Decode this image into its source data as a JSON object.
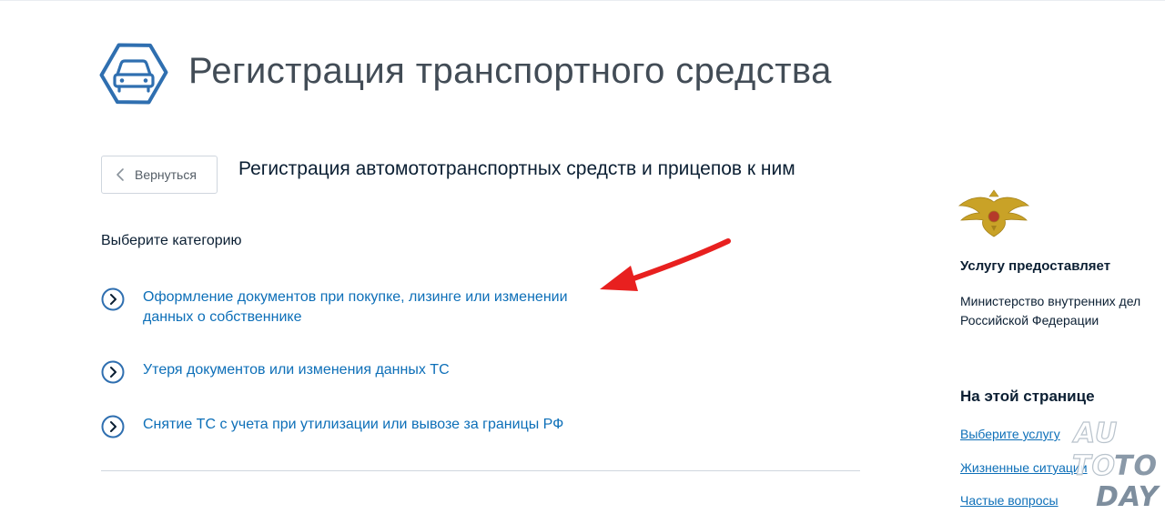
{
  "header": {
    "title": "Регистрация транспортного средства",
    "icon": "car-icon"
  },
  "nav": {
    "back_label": "Вернуться"
  },
  "service": {
    "subtitle": "Регистрация автомототранспортных средств и прицепов к ним",
    "choose_label": "Выберите категорию",
    "options": [
      {
        "label": "Оформление документов при покупке, лизинге или изменении данных о собственнике",
        "icon": "chevron-right-circle-icon"
      },
      {
        "label": "Утеря документов или изменения данных ТС",
        "icon": "chevron-right-circle-icon"
      },
      {
        "label": "Снятие ТС с учета при утилизации или вывозе за границы РФ",
        "icon": "chevron-right-circle-icon"
      }
    ]
  },
  "sidebar": {
    "emblem": "emblem-icon",
    "provider_heading": "Услугу предоставляет",
    "provider_name": "Министерство внутренних дел Российской Федерации",
    "toc_heading": "На этой странице",
    "toc_links": [
      "Выберите услугу",
      "Жизненные ситуации",
      "Частые вопросы"
    ]
  },
  "watermark": {
    "line1": "AU",
    "line2a": "TO",
    "line2b": "TO",
    "line3": "DAY"
  },
  "colors": {
    "accent": "#0d6fb8",
    "icon_blue": "#2f6fb0",
    "text": "#0b1f33",
    "title": "#424c56",
    "arrow": "#e8201f",
    "emblem_gold": "#c9a227"
  }
}
